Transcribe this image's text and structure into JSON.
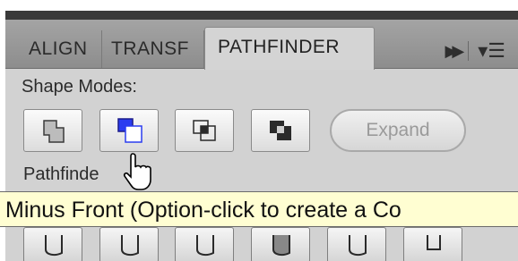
{
  "tabs": [
    {
      "label": "ALIGN"
    },
    {
      "label": "TRANSF"
    },
    {
      "label": "PATHFINDER"
    }
  ],
  "panel_menu": {
    "fastforward_icon": "fast-forward-icon",
    "menu_icon": "panel-menu-icon",
    "fastforward_glyph": "▶▶",
    "menu_glyph": "▾☰"
  },
  "shape_modes": {
    "label": "Shape Modes:",
    "buttons": [
      {
        "name": "unite",
        "icon": "unite-icon"
      },
      {
        "name": "minus-front",
        "icon": "minus-front-icon",
        "state": "hover"
      },
      {
        "name": "intersect",
        "icon": "intersect-icon"
      },
      {
        "name": "exclude",
        "icon": "exclude-icon"
      }
    ],
    "expand_label": "Expand"
  },
  "pathfinders": {
    "label": "Pathfinde",
    "buttons": [
      {
        "name": "divide",
        "icon": "divide-icon"
      },
      {
        "name": "trim",
        "icon": "trim-icon"
      },
      {
        "name": "merge",
        "icon": "merge-icon"
      },
      {
        "name": "crop",
        "icon": "crop-icon"
      },
      {
        "name": "outline",
        "icon": "outline-icon"
      },
      {
        "name": "minus-back",
        "icon": "minus-back-icon"
      }
    ]
  },
  "tooltip": {
    "text": "Minus Front (Option-click to create a Co"
  },
  "colors": {
    "panel_bg": "#d2d2d2",
    "tooltip_bg": "#fffed2",
    "highlight": "#2b3df0"
  }
}
